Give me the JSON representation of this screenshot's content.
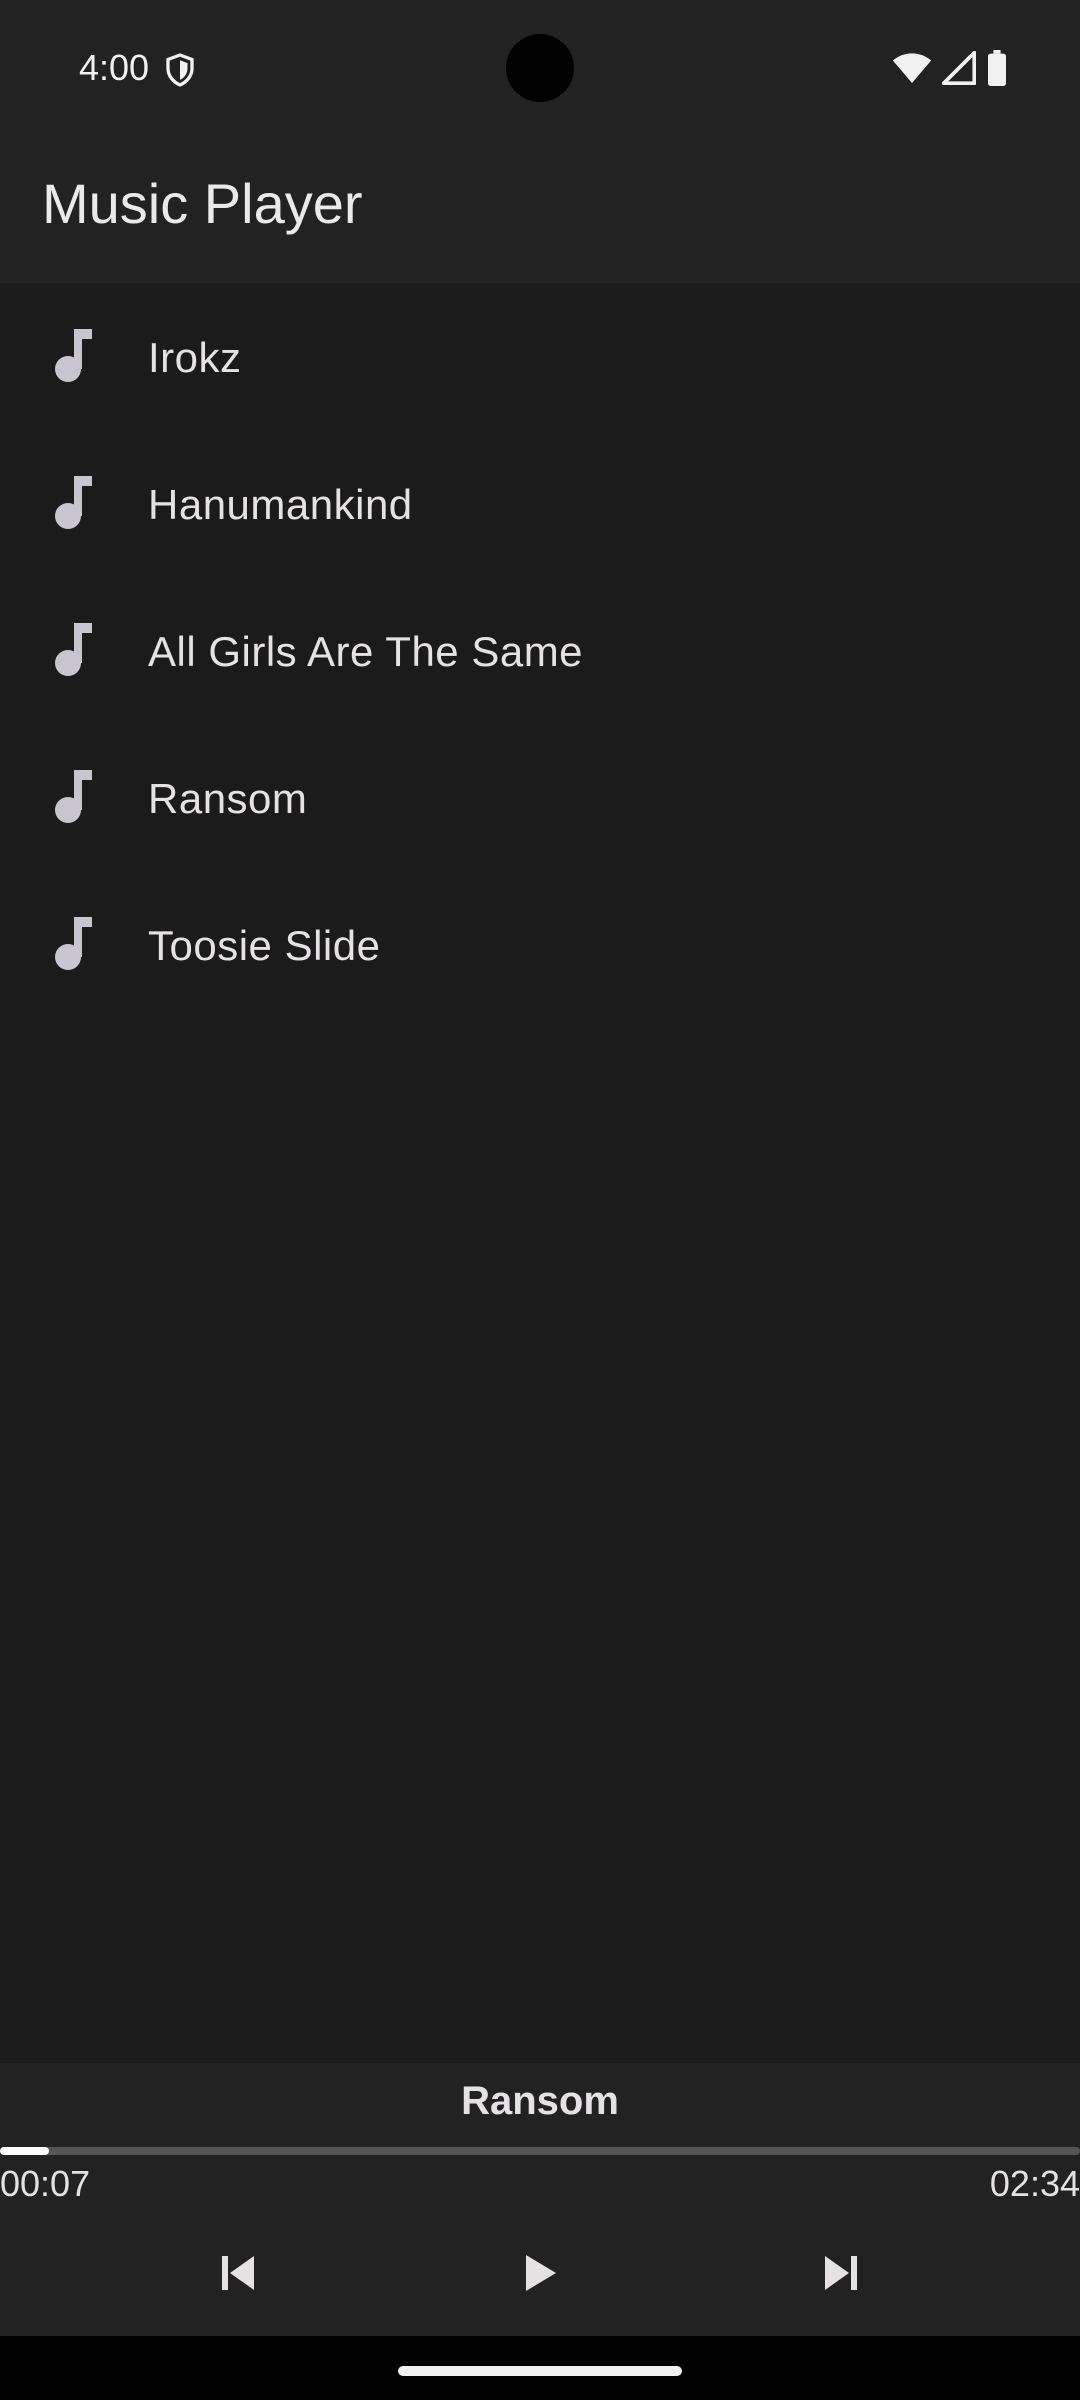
{
  "status_bar": {
    "time": "4:00",
    "icons": [
      "shield-icon",
      "wifi-icon",
      "cell-signal-icon",
      "battery-icon"
    ]
  },
  "app_bar": {
    "title": "Music Player"
  },
  "songs": [
    {
      "title": "Irokz",
      "icon": "music-note-icon"
    },
    {
      "title": "Hanumankind",
      "icon": "music-note-icon"
    },
    {
      "title": "All Girls Are The Same",
      "icon": "music-note-icon"
    },
    {
      "title": "Ransom",
      "icon": "music-note-icon"
    },
    {
      "title": "Toosie Slide",
      "icon": "music-note-icon"
    }
  ],
  "player": {
    "now_playing": "Ransom",
    "current_time": "00:07",
    "total_time": "02:34",
    "progress_fraction": 0.045,
    "controls": [
      "skip-previous-icon",
      "play-icon",
      "skip-next-icon"
    ]
  },
  "colors": {
    "background": "#1b1b1b",
    "surface": "#222222",
    "text": "#e6e1e5",
    "icon": "#c9c5d0",
    "progress": "#ffffff",
    "track": "#555555"
  }
}
